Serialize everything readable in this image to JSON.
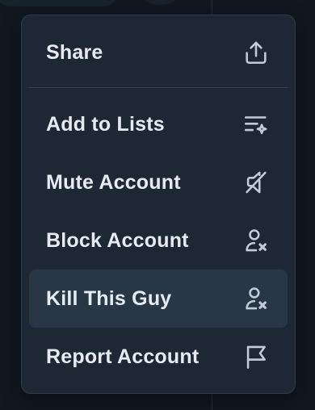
{
  "menu": {
    "items": [
      {
        "label": "Share",
        "icon": "share-icon"
      },
      {
        "label": "Add to Lists",
        "icon": "list-sparkle-icon"
      },
      {
        "label": "Mute Account",
        "icon": "mute-icon"
      },
      {
        "label": "Block Account",
        "icon": "person-x-icon"
      },
      {
        "label": "Kill This Guy",
        "icon": "person-x-icon",
        "highlighted": true
      },
      {
        "label": "Report Account",
        "icon": "flag-icon"
      }
    ]
  },
  "colors": {
    "menu_bg": "#1d2834",
    "highlight": "#283746",
    "text": "#e5ebf1",
    "icon": "#c3ccd6"
  }
}
